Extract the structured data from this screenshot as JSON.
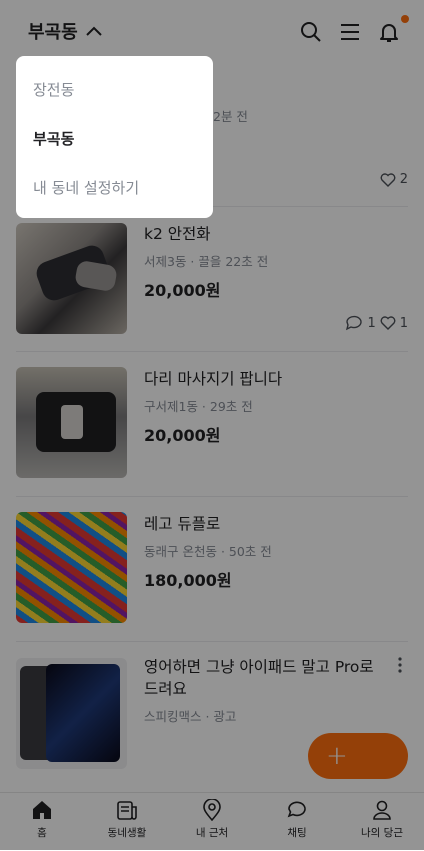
{
  "header": {
    "location": "부곡동"
  },
  "items": [
    {
      "title": "",
      "meta": "2분 전",
      "price": "",
      "likes": "2",
      "chats": ""
    },
    {
      "title": "k2 안전화",
      "meta": "서제3동 · 끌을 22초 전",
      "price": "20,000원",
      "chats": "1",
      "likes": "1"
    },
    {
      "title": "다리 마사지기 팝니다",
      "meta": "구서제1동 · 29초 전",
      "price": "20,000원"
    },
    {
      "title": "레고 듀플로",
      "meta": "동래구 온천동 · 50초 전",
      "price": "180,000원"
    },
    {
      "title": "영어하면 그냥 아이패드 말고 Pro로 드려요",
      "meta": "스피킹맥스 · 광고"
    }
  ],
  "fab": {
    "label": "+"
  },
  "tabs": [
    {
      "label": "홈",
      "icon": "home-icon"
    },
    {
      "label": "동네생활",
      "icon": "community-icon"
    },
    {
      "label": "내 근처",
      "icon": "map-pin-icon"
    },
    {
      "label": "채팅",
      "icon": "chat-icon"
    },
    {
      "label": "나의 당근",
      "icon": "person-icon"
    }
  ],
  "dropdown": {
    "items": [
      {
        "label": "장전동",
        "selected": false
      },
      {
        "label": "부곡동",
        "selected": true
      },
      {
        "label": "내 동네 설정하기",
        "selected": false
      }
    ]
  },
  "colors": {
    "accent": "#ff6f0f",
    "overlay": "rgba(0,0,0,0.42)"
  }
}
